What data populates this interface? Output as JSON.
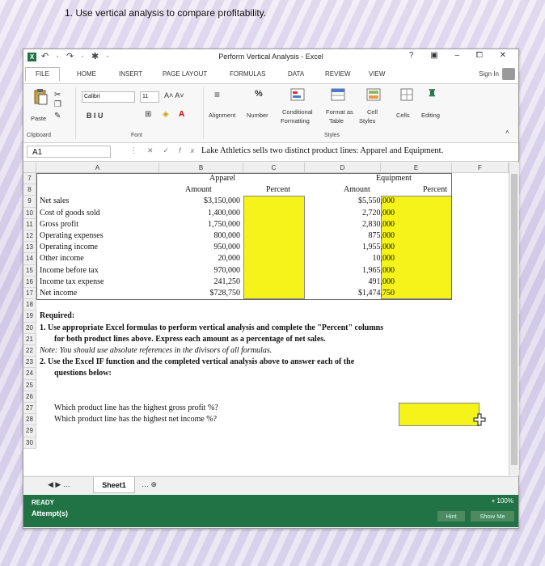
{
  "question": "1. Use vertical analysis to compare profitability.",
  "window": {
    "title": "Perform Vertical Analysis - Excel",
    "controls": "? ▣ – ⧠ ✕",
    "qat": "↶ · ↷ · ✱ ·"
  },
  "tabs": [
    "FILE",
    "HOME",
    "INSERT",
    "PAGE LAYOUT",
    "FORMULAS",
    "DATA",
    "REVIEW",
    "VIEW"
  ],
  "sign_in": "Sign In",
  "ribbon": {
    "paste": "Paste",
    "font_name": "Calibri",
    "font_size": "11",
    "font_grow": "A˄ A˅",
    "bold_italic_underline": "B  I  U",
    "alignment": "Alignment",
    "number": "Number",
    "number_sym": "%",
    "conditional": "Conditional",
    "formatting": "Formatting",
    "format_as": "Format as",
    "table": "Table",
    "cell": "Cell",
    "styles_btn": "Styles",
    "cells": "Cells",
    "editing": "Editing",
    "groups": {
      "clipboard": "Clipboard",
      "font": "Font",
      "styles": "Styles"
    }
  },
  "formula_bar": {
    "name_box": "A1",
    "formula": "Lake Athletics sells two distinct product lines: Apparel and Equipment."
  },
  "columns": [
    "A",
    "B",
    "C",
    "D",
    "E",
    "F"
  ],
  "rows": [
    "7",
    "8",
    "9",
    "10",
    "11",
    "12",
    "13",
    "14",
    "15",
    "16",
    "17",
    "18",
    "19",
    "20",
    "21",
    "22",
    "23",
    "24",
    "25",
    "26",
    "27",
    "28",
    "29",
    "30"
  ],
  "table": {
    "apparel_header": "Apparel",
    "equipment_header": "Equipment",
    "amount_header": "Amount",
    "percent_header": "Percent",
    "lines": [
      {
        "label": "Net sales",
        "apparel": "$3,150,000",
        "equipment": "$5,550,000"
      },
      {
        "label": "Cost of goods sold",
        "apparel": "1,400,000",
        "equipment": "2,720,000"
      },
      {
        "label": "Gross profit",
        "apparel": "1,750,000",
        "equipment": "2,830,000"
      },
      {
        "label": "Operating expenses",
        "apparel": "800,000",
        "equipment": "875,000"
      },
      {
        "label": "Operating income",
        "apparel": "950,000",
        "equipment": "1,955,000"
      },
      {
        "label": "Other income",
        "apparel": "20,000",
        "equipment": "10,000"
      },
      {
        "label": "Income before tax",
        "apparel": "970,000",
        "equipment": "1,965,000"
      },
      {
        "label": "Income tax expense",
        "apparel": "241,250",
        "equipment": "491,000"
      },
      {
        "label": "Net income",
        "apparel": "$728,750",
        "equipment": "$1,474,750"
      }
    ]
  },
  "instructions": {
    "required": "Required:",
    "line1": "1. Use appropriate Excel formulas to perform vertical analysis and complete the \"Percent\" columns",
    "line2": "for both product lines above. Express each amount as a percentage of net sales.",
    "note": "Note: You should use absolute references in the divisors of all formulas.",
    "line3": "2. Use the Excel IF function and the completed vertical analysis above to answer each of the",
    "line4": "questions below:",
    "q1": "Which product line has the highest gross profit %?",
    "q2": "Which product line has the highest net income %?"
  },
  "sheet_tab": "Sheet1",
  "status": {
    "ready": "READY",
    "zoom": "+ 100%",
    "attempts": "Attempt(s)",
    "hint": "Hint",
    "show_me": "Show Me"
  },
  "colors": {
    "excel_green": "#217346",
    "answer_yellow": "#f6f31a"
  }
}
